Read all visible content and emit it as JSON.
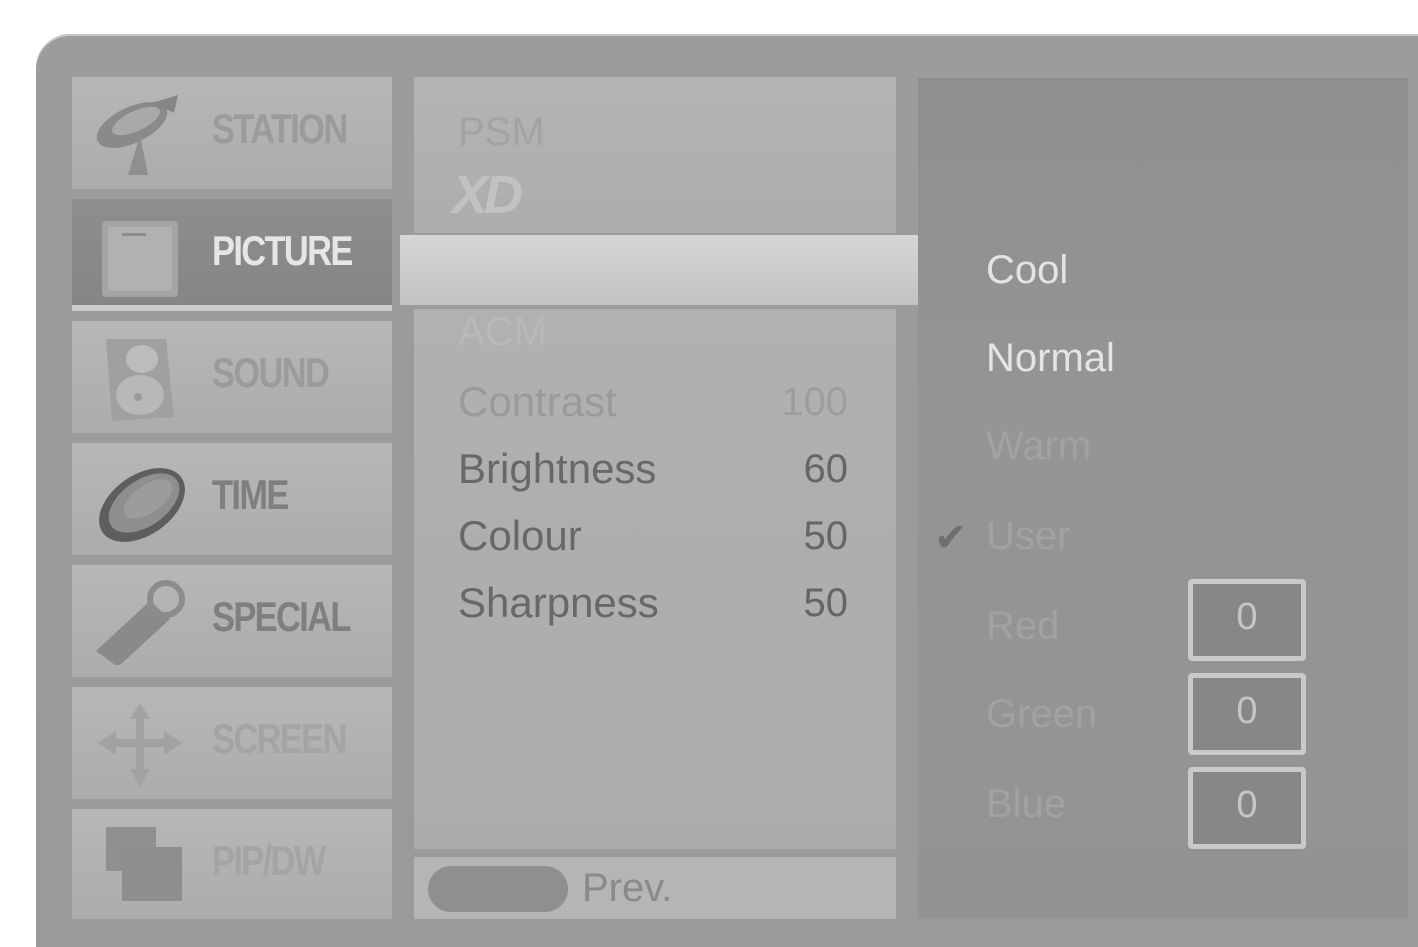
{
  "categories": [
    {
      "label": "STATION",
      "icon": "satellite-dish-icon",
      "selected": false,
      "tone": "normal"
    },
    {
      "label": "PICTURE",
      "icon": "picture-frame-icon",
      "selected": true,
      "tone": "selected"
    },
    {
      "label": "SOUND",
      "icon": "speaker-icon",
      "selected": false,
      "tone": "normal"
    },
    {
      "label": "TIME",
      "icon": "clock-disc-icon",
      "selected": false,
      "tone": "bright"
    },
    {
      "label": "SPECIAL",
      "icon": "key-tag-icon",
      "selected": false,
      "tone": "bright"
    },
    {
      "label": "SCREEN",
      "icon": "move-arrows-icon",
      "selected": false,
      "tone": "dim"
    },
    {
      "label": "PIP/DW",
      "icon": "overlapping-windows-icon",
      "selected": false,
      "tone": "dim"
    }
  ],
  "picture_menu": {
    "psm_label": "PSM",
    "xd_label": "XD",
    "highlighted_item": "",
    "acm_label": "ACM",
    "settings": [
      {
        "label": "Contrast",
        "value": "100",
        "dim": true
      },
      {
        "label": "Brightness",
        "value": "60",
        "dim": false
      },
      {
        "label": "Colour",
        "value": "50",
        "dim": false
      },
      {
        "label": "Sharpness",
        "value": "50",
        "dim": false
      }
    ],
    "prev_label": "Prev."
  },
  "colour_temperature": {
    "options": [
      {
        "label": "Cool",
        "dim": false,
        "checked": false
      },
      {
        "label": "Normal",
        "dim": false,
        "checked": false
      },
      {
        "label": "Warm",
        "dim": true,
        "checked": false
      },
      {
        "label": "User",
        "dim": true,
        "checked": true
      }
    ],
    "check_mark": "✔",
    "user_values": [
      {
        "label": "Red",
        "value": "0"
      },
      {
        "label": "Green",
        "value": "0"
      },
      {
        "label": "Blue",
        "value": "0"
      }
    ]
  }
}
